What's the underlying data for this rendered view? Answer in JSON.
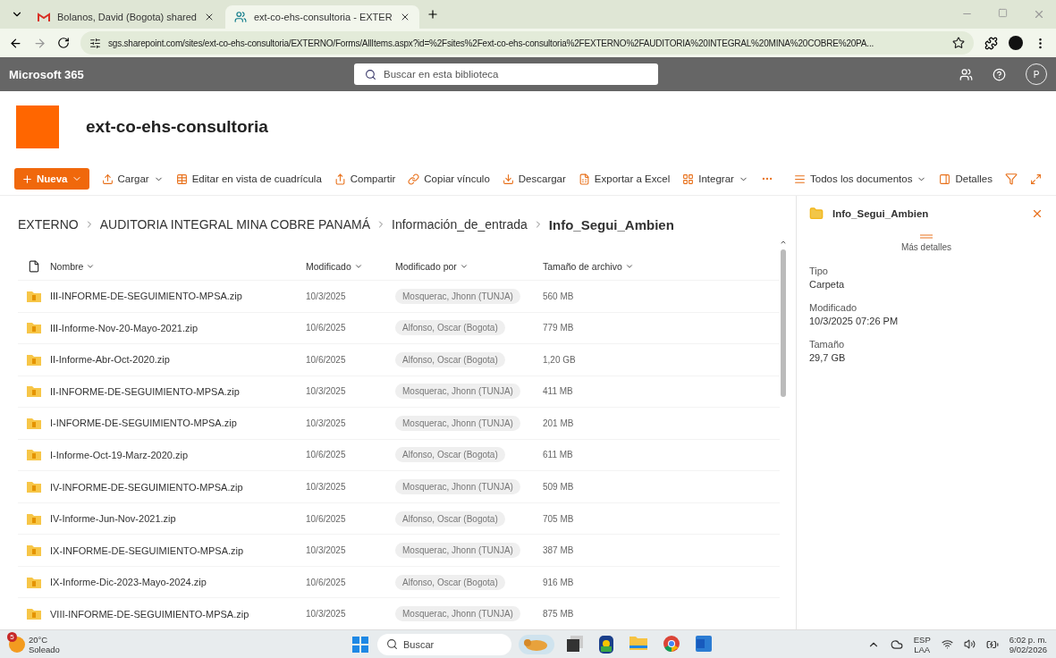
{
  "browser": {
    "tabs": [
      {
        "title": "Bolanos, David (Bogota) shared",
        "selected": false,
        "kind": "mail"
      },
      {
        "title": "ext-co-ehs-consultoria - EXTER",
        "selected": true,
        "kind": "site"
      }
    ],
    "address": "sgs.sharepoint.com/sites/ext-co-ehs-consultoria/EXTERNO/Forms/AllItems.aspx?id=%2Fsites%2Fext-co-ehs-consultoria%2FEXTERNO%2FAUDITORIA%20INTEGRAL%20MINA%20COBRE%20PA..."
  },
  "suite_bar": {
    "brand": "Microsoft 365",
    "search": {
      "placeholder": "Buscar en esta biblioteca"
    },
    "avatar": "P"
  },
  "site": {
    "title": "ext-co-ehs-consultoria"
  },
  "toolbar": {
    "new": "Nueva",
    "commands": [
      {
        "label": "Cargar",
        "dropdown": true
      },
      {
        "label": "Editar en vista de cuadrícula",
        "dropdown": false
      },
      {
        "label": "Compartir",
        "dropdown": false
      },
      {
        "label": "Copiar vínculo",
        "dropdown": false
      },
      {
        "label": "Descargar",
        "dropdown": false
      },
      {
        "label": "Exportar a Excel",
        "dropdown": false
      },
      {
        "label": "Integrar",
        "dropdown": true
      }
    ],
    "view": "Todos los documentos",
    "details": "Detalles"
  },
  "breadcrumb": [
    "EXTERNO",
    "AUDITORIA INTEGRAL MINA COBRE PANAMÁ",
    "Información_de_entrada",
    "Info_Segui_Ambien"
  ],
  "table": {
    "columns": [
      "Nombre",
      "Modificado",
      "Modificado por",
      "Tamaño de archivo"
    ],
    "rows": [
      {
        "name": "III-INFORME-DE-SEGUIMIENTO-MPSA.zip",
        "modified": "10/3/2025",
        "by": "Mosquerac, Jhonn (TUNJA)",
        "size": "560 MB"
      },
      {
        "name": "III-Informe-Nov-20-Mayo-2021.zip",
        "modified": "10/6/2025",
        "by": "Alfonso, Oscar (Bogota)",
        "size": "779 MB"
      },
      {
        "name": "II-Informe-Abr-Oct-2020.zip",
        "modified": "10/6/2025",
        "by": "Alfonso, Oscar (Bogota)",
        "size": "1,20 GB"
      },
      {
        "name": "II-INFORME-DE-SEGUIMIENTO-MPSA.zip",
        "modified": "10/3/2025",
        "by": "Mosquerac, Jhonn (TUNJA)",
        "size": "411 MB"
      },
      {
        "name": "I-INFORME-DE-SEGUIMIENTO-MPSA.zip",
        "modified": "10/3/2025",
        "by": "Mosquerac, Jhonn (TUNJA)",
        "size": "201 MB"
      },
      {
        "name": "I-Informe-Oct-19-Marz-2020.zip",
        "modified": "10/6/2025",
        "by": "Alfonso, Oscar (Bogota)",
        "size": "611 MB"
      },
      {
        "name": "IV-INFORME-DE-SEGUIMIENTO-MPSA.zip",
        "modified": "10/3/2025",
        "by": "Mosquerac, Jhonn (TUNJA)",
        "size": "509 MB"
      },
      {
        "name": "IV-Informe-Jun-Nov-2021.zip",
        "modified": "10/6/2025",
        "by": "Alfonso, Oscar (Bogota)",
        "size": "705 MB"
      },
      {
        "name": "IX-INFORME-DE-SEGUIMIENTO-MPSA.zip",
        "modified": "10/3/2025",
        "by": "Mosquerac, Jhonn (TUNJA)",
        "size": "387 MB"
      },
      {
        "name": "IX-Informe-Dic-2023-Mayo-2024.zip",
        "modified": "10/6/2025",
        "by": "Alfonso, Oscar (Bogota)",
        "size": "916 MB"
      },
      {
        "name": "VIII-INFORME-DE-SEGUIMIENTO-MPSA.zip",
        "modified": "10/3/2025",
        "by": "Mosquerac, Jhonn (TUNJA)",
        "size": "875 MB"
      }
    ]
  },
  "details_pane": {
    "title": "Info_Segui_Ambien",
    "more": "Más detalles",
    "fields": [
      {
        "label": "Tipo",
        "value": "Carpeta"
      },
      {
        "label": "Modificado",
        "value": "10/3/2025 07:26 PM"
      },
      {
        "label": "Tamaño",
        "value": "29,7 GB"
      }
    ]
  },
  "taskbar": {
    "weather": {
      "badge": "5",
      "temp": "20°C",
      "text": "Soleado"
    },
    "search": "Buscar",
    "lang": "ESP",
    "region": "LAA",
    "time": "6:02 p. m.",
    "date": "9/02/2026"
  }
}
